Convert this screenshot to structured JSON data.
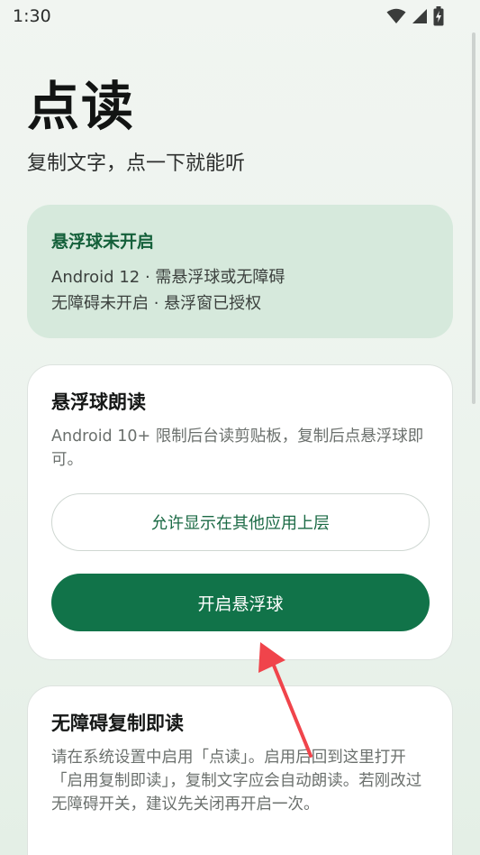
{
  "status_bar": {
    "time": "1:30",
    "icons": [
      "wifi-icon",
      "signal-icon",
      "battery-charging-icon"
    ]
  },
  "header": {
    "title": "点读",
    "subtitle": "复制文字，点一下就能听"
  },
  "status_card": {
    "title": "悬浮球未开启",
    "line1": "Android 12 · 需悬浮球或无障碍",
    "line2": "无障碍未开启 · 悬浮窗已授权"
  },
  "floating_card": {
    "title": "悬浮球朗读",
    "description": "Android 10+ 限制后台读剪贴板，复制后点悬浮球即可。",
    "overlay_button": "允许显示在其他应用上层",
    "enable_button": "开启悬浮球"
  },
  "accessibility_card": {
    "title": "无障碍复制即读",
    "description": "请在系统设置中启用「点读」。启用后回到这里打开「启用复制即读」，复制文字应会自动朗读。若刚改过无障碍开关，建议先关闭再开启一次。"
  },
  "colors": {
    "accent": "#117349",
    "status_card_bg": "#d6e9dc",
    "annotation_arrow": "#f0444b"
  }
}
